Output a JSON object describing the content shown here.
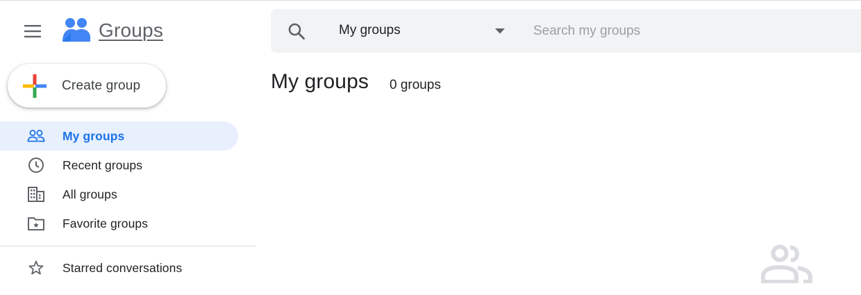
{
  "app": {
    "name": "Groups"
  },
  "sidebar": {
    "create_label": "Create group",
    "items": [
      {
        "label": "My groups",
        "icon": "people-icon",
        "active": true
      },
      {
        "label": "Recent groups",
        "icon": "clock-icon",
        "active": false
      },
      {
        "label": "All groups",
        "icon": "building-icon",
        "active": false
      },
      {
        "label": "Favorite groups",
        "icon": "folder-star-icon",
        "active": false
      }
    ],
    "starred": {
      "label": "Starred conversations",
      "icon": "star-icon"
    }
  },
  "search": {
    "scope": "My groups",
    "placeholder": "Search my groups"
  },
  "main": {
    "title": "My groups",
    "count": "0 groups"
  },
  "colors": {
    "accent": "#1a73e8",
    "active_bg": "#e8f0fe",
    "search_bg": "#f1f3f4",
    "logo_blue": "#4285f4",
    "icon_gray": "#5f6368",
    "empty_icon": "#dadce0"
  }
}
